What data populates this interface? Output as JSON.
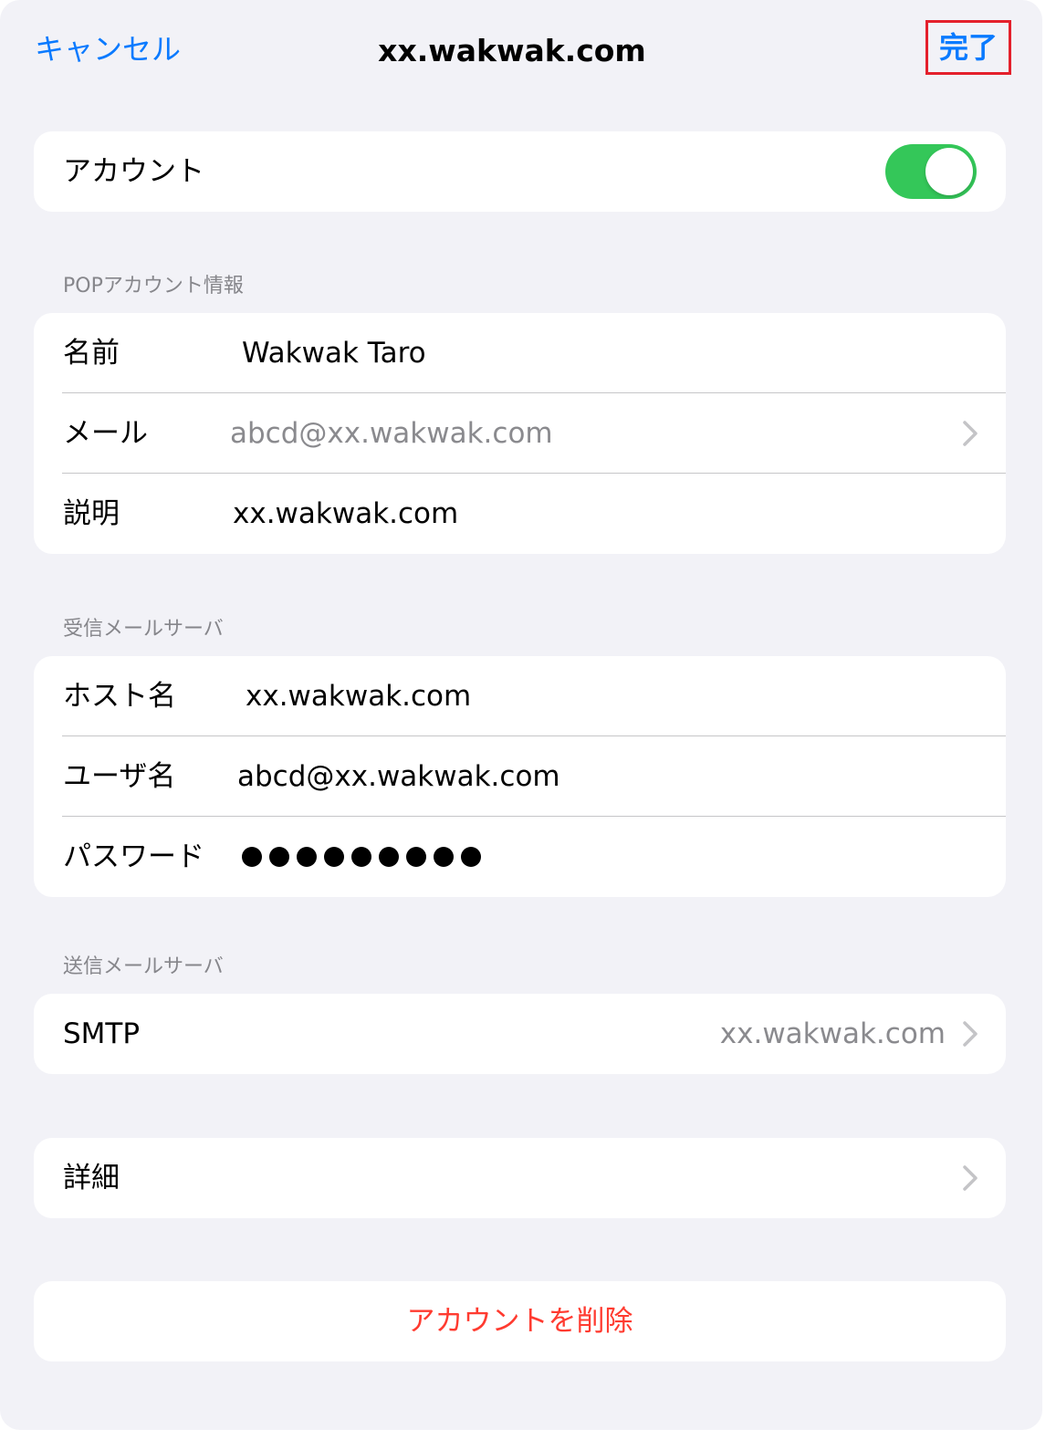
{
  "nav": {
    "cancel": "キャンセル",
    "title": "xx.wakwak.com",
    "done": "完了"
  },
  "account": {
    "label": "アカウント",
    "enabled": true
  },
  "pop_section": {
    "header": "POPアカウント情報",
    "name_label": "名前",
    "name_value": "Wakwak Taro",
    "mail_label": "メール",
    "mail_value": "abcd@xx.wakwak.com",
    "desc_label": "説明",
    "desc_value": "xx.wakwak.com"
  },
  "incoming": {
    "header": "受信メールサーバ",
    "host_label": "ホスト名",
    "host_value": "xx.wakwak.com",
    "user_label": "ユーザ名",
    "user_value": "abcd@xx.wakwak.com",
    "password_label": "パスワード",
    "password_dots": 9
  },
  "outgoing": {
    "header": "送信メールサーバ",
    "smtp_label": "SMTP",
    "smtp_value": "xx.wakwak.com"
  },
  "details": {
    "label": "詳細"
  },
  "delete": {
    "label": "アカウントを削除"
  },
  "colors": {
    "accent": "#0a7aff",
    "toggle_on": "#34c759",
    "destructive": "#ff3b30",
    "highlight_box": "#e4202c"
  }
}
